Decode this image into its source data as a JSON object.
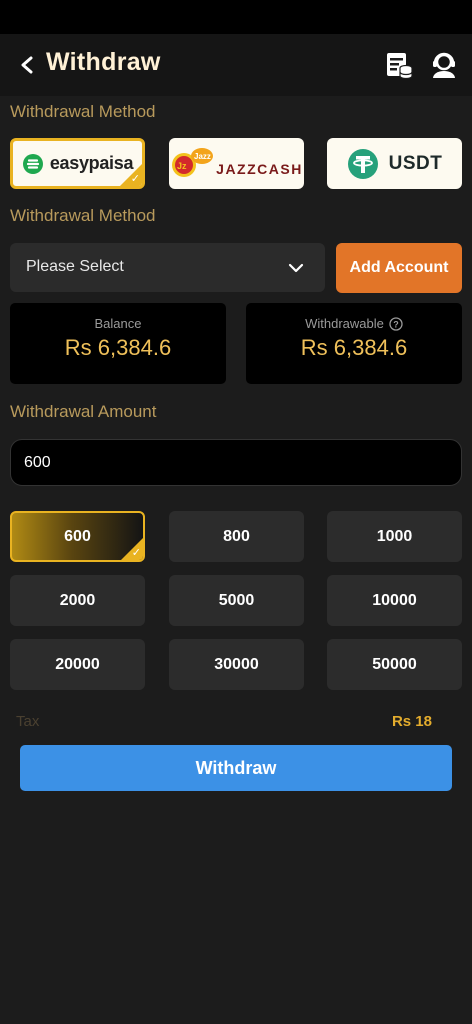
{
  "header": {
    "title": "Withdraw",
    "back_icon": "chevron-left-icon",
    "records_icon": "records-icon",
    "support_icon": "customer-service-icon"
  },
  "method_section": {
    "label": "Withdrawal Method",
    "methods": [
      {
        "name": "easypaisa",
        "selected": true
      },
      {
        "name": "JAZZCASH",
        "badge": "Jazz Cash",
        "selected": false
      },
      {
        "name": "USDT",
        "selected": false
      }
    ]
  },
  "account_section": {
    "label": "Withdrawal Method",
    "select_placeholder": "Please Select",
    "add_account_label": "Add Account"
  },
  "balance": {
    "balance_label": "Balance",
    "balance_value": "Rs 6,384.6",
    "withdrawable_label": "Withdrawable",
    "withdrawable_value": "Rs 6,384.6"
  },
  "amount": {
    "label": "Withdrawal Amount",
    "input_value": "600",
    "chips": [
      "600",
      "800",
      "1000",
      "2000",
      "5000",
      "10000",
      "20000",
      "30000",
      "50000"
    ],
    "selected_chip": "600"
  },
  "tax": {
    "label": "Tax",
    "value": "Rs 18"
  },
  "submit_label": "Withdraw",
  "colors": {
    "accent_gold": "#e9b321",
    "balance_gold": "#efc05a",
    "add_account_orange": "#e27528",
    "withdraw_blue": "#3c91e6",
    "background": "#1c1c1c"
  }
}
